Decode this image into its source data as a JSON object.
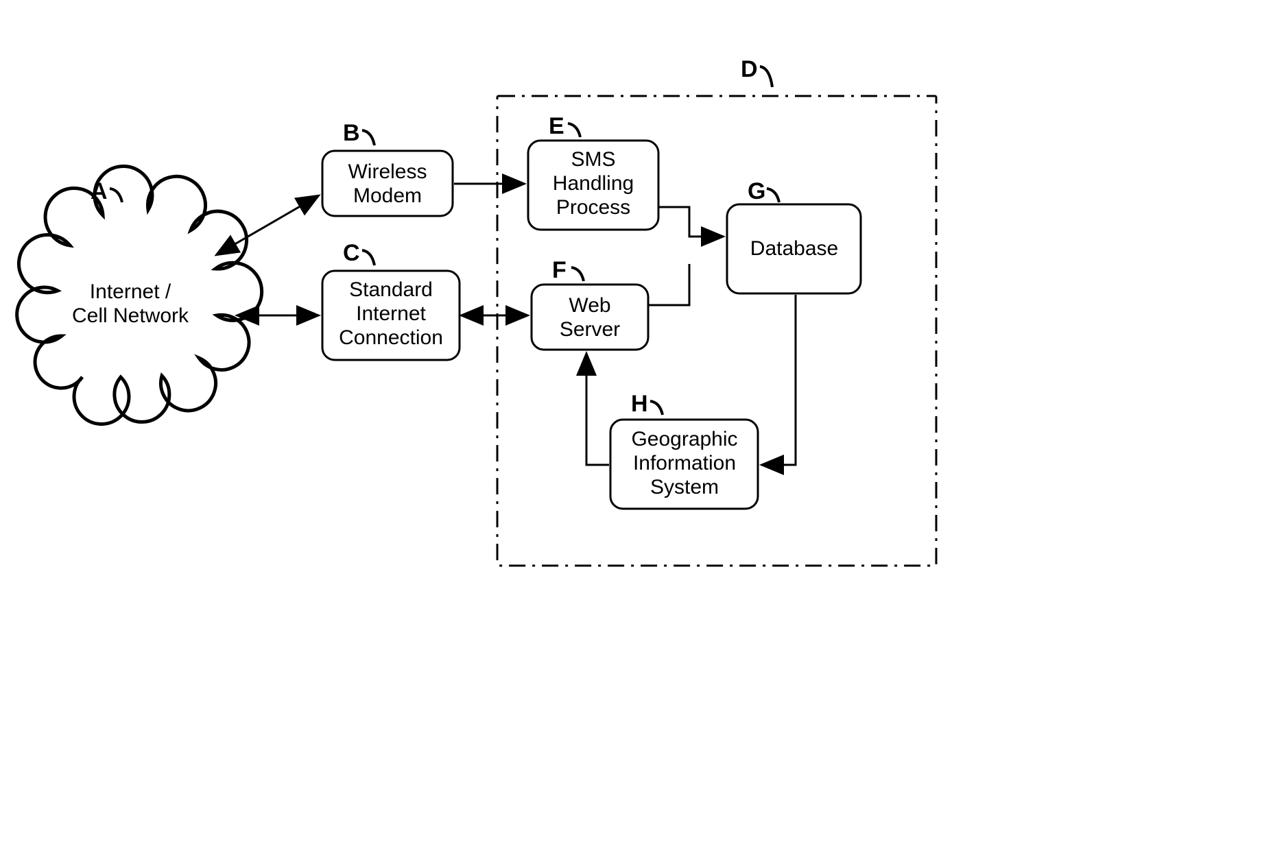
{
  "nodes": {
    "A": {
      "ref": "A",
      "line1": "Internet /",
      "line2": "Cell Network",
      "line3": ""
    },
    "B": {
      "ref": "B",
      "line1": "Wireless",
      "line2": "Modem",
      "line3": ""
    },
    "C": {
      "ref": "C",
      "line1": "Standard",
      "line2": "Internet",
      "line3": "Connection"
    },
    "D": {
      "ref": "D",
      "line1": "",
      "line2": "",
      "line3": ""
    },
    "E": {
      "ref": "E",
      "line1": "SMS",
      "line2": "Handling",
      "line3": "Process"
    },
    "F": {
      "ref": "F",
      "line1": "Web",
      "line2": "Server",
      "line3": ""
    },
    "G": {
      "ref": "G",
      "line1": "Database",
      "line2": "",
      "line3": ""
    },
    "H": {
      "ref": "H",
      "line1": "Geographic",
      "line2": "Information",
      "line3": "System"
    }
  },
  "edges": [
    {
      "from": "A",
      "to": "B",
      "bidir": true
    },
    {
      "from": "A",
      "to": "C",
      "bidir": true
    },
    {
      "from": "B",
      "to": "E",
      "bidir": false
    },
    {
      "from": "C",
      "to": "F",
      "bidir": true
    },
    {
      "from": "E",
      "to": "G",
      "bidir": false
    },
    {
      "from": "F",
      "to": "G",
      "bidir": false
    },
    {
      "from": "G",
      "to": "H",
      "bidir": false
    },
    {
      "from": "H",
      "to": "F",
      "bidir": false
    }
  ]
}
